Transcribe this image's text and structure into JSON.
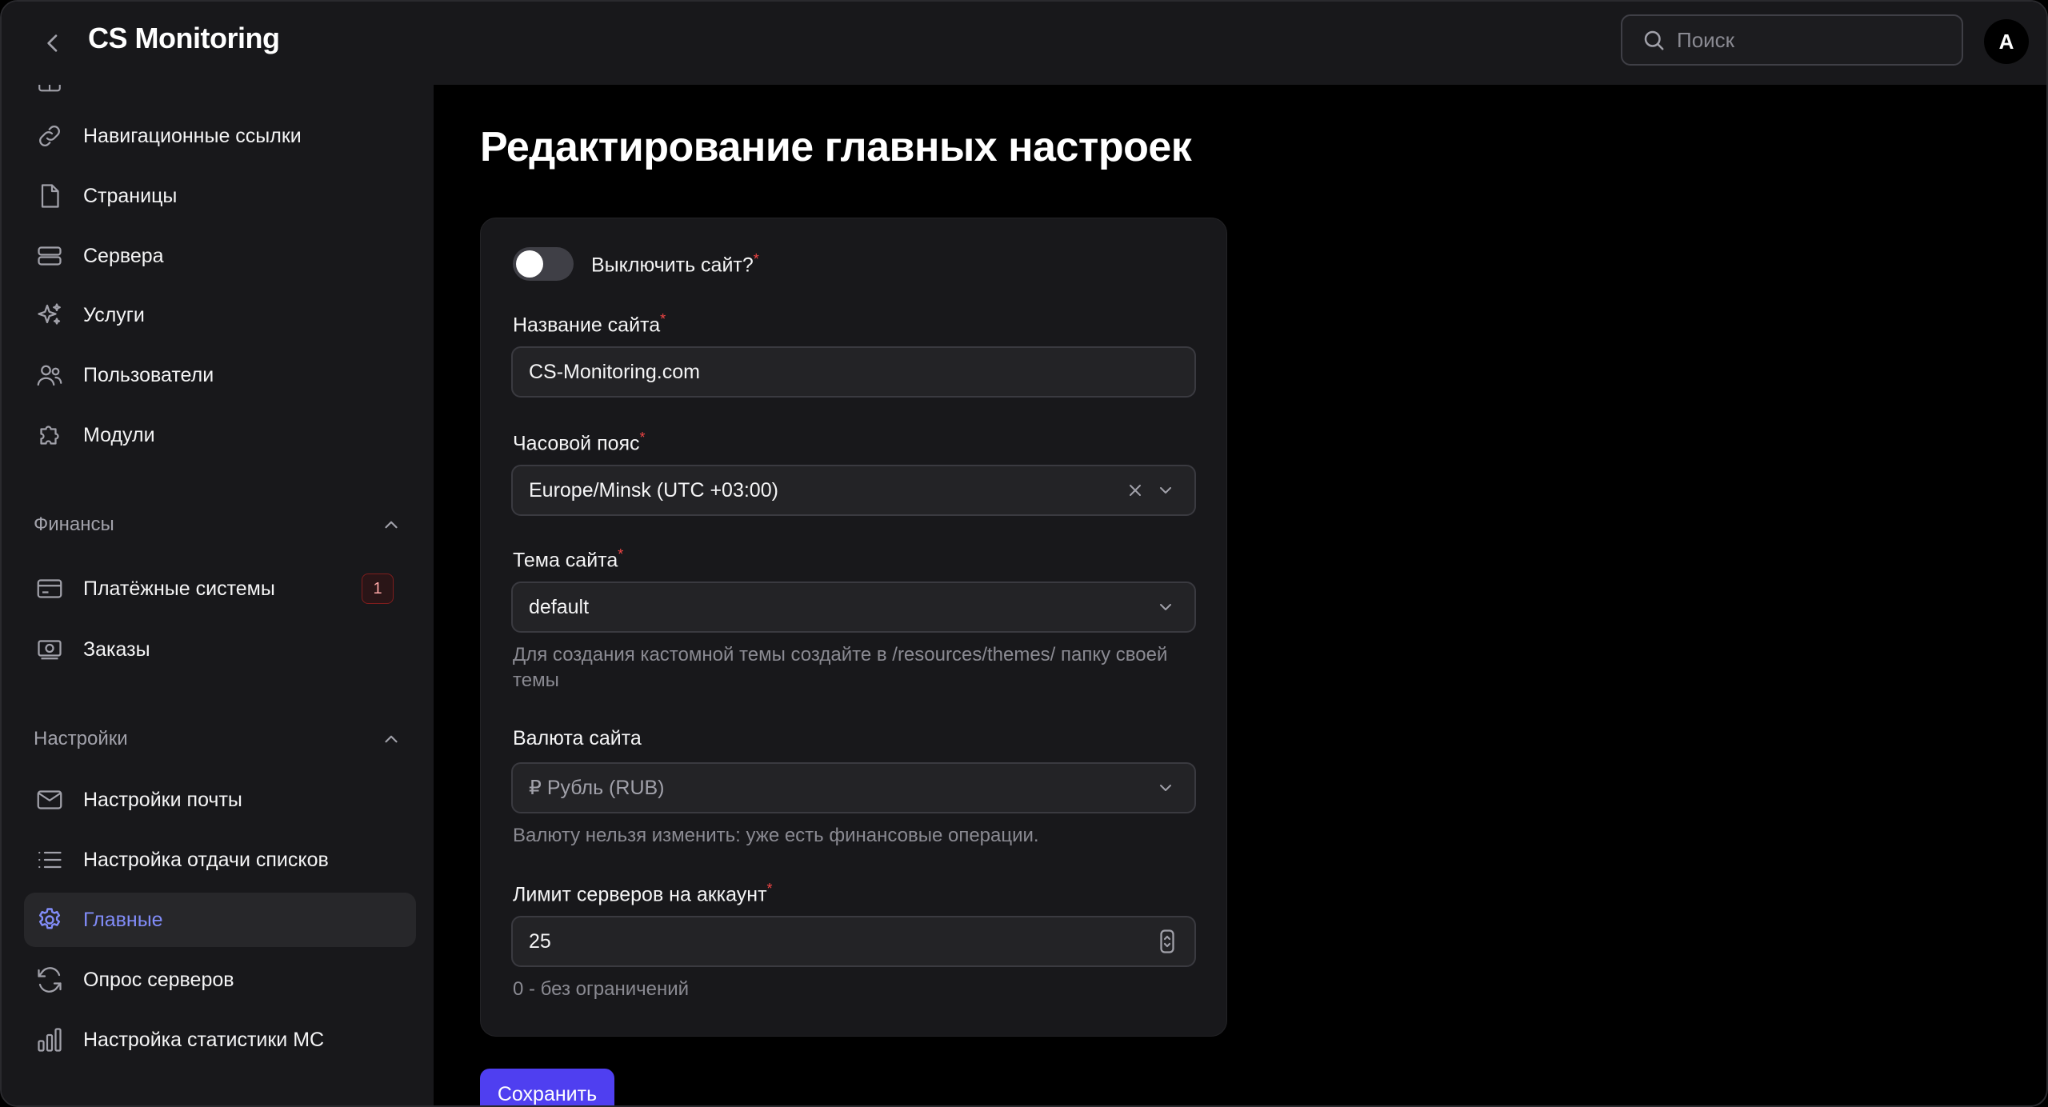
{
  "header": {
    "title": "CS Monitoring",
    "search_placeholder": "Поиск",
    "avatar_initial": "A"
  },
  "sidebar": {
    "items_top": [
      {
        "label": "Навигационные ссылки",
        "icon": "link-icon"
      },
      {
        "label": "Страницы",
        "icon": "file-icon"
      },
      {
        "label": "Сервера",
        "icon": "server-icon"
      },
      {
        "label": "Услуги",
        "icon": "sparkles-icon"
      },
      {
        "label": "Пользователи",
        "icon": "users-icon"
      },
      {
        "label": "Модули",
        "icon": "puzzle-icon"
      }
    ],
    "finance_section": {
      "label": "Финансы",
      "items": [
        {
          "label": "Платёжные системы",
          "icon": "credit-card-icon",
          "badge": "1"
        },
        {
          "label": "Заказы",
          "icon": "cash-icon"
        }
      ]
    },
    "settings_section": {
      "label": "Настройки",
      "items": [
        {
          "label": "Настройки почты",
          "icon": "mail-icon"
        },
        {
          "label": "Настройка отдачи списков",
          "icon": "list-icon"
        },
        {
          "label": "Главные",
          "icon": "gear-icon",
          "active": true
        },
        {
          "label": "Опрос серверов",
          "icon": "refresh-icon"
        },
        {
          "label": "Настройка статистики МС",
          "icon": "bar-chart-icon"
        }
      ]
    }
  },
  "main": {
    "title": "Редактирование главных настроек",
    "form": {
      "disable_site": {
        "label": "Выключить сайт?",
        "required": "*",
        "enabled": false
      },
      "site_name": {
        "label": "Название сайта",
        "required": "*",
        "value": "CS-Monitoring.com"
      },
      "timezone": {
        "label": "Часовой пояс",
        "required": "*",
        "value": "Europe/Minsk (UTC +03:00)"
      },
      "theme": {
        "label": "Тема сайта",
        "required": "*",
        "value": "default",
        "hint": "Для создания кастомной темы создайте в /resources/themes/ папку своей темы"
      },
      "currency": {
        "label": "Валюта сайта",
        "value": "₽ Рубль (RUB)",
        "hint": "Валюту нельзя изменить: уже есть финансовые операции."
      },
      "server_limit": {
        "label": "Лимит серверов на аккаунт",
        "required": "*",
        "value": "25",
        "hint": "0 - без ограничений"
      }
    },
    "save_label": "Сохранить"
  },
  "colors": {
    "accent": "#4f3ff0",
    "active_text": "#818cf8",
    "required": "#ef4444"
  }
}
